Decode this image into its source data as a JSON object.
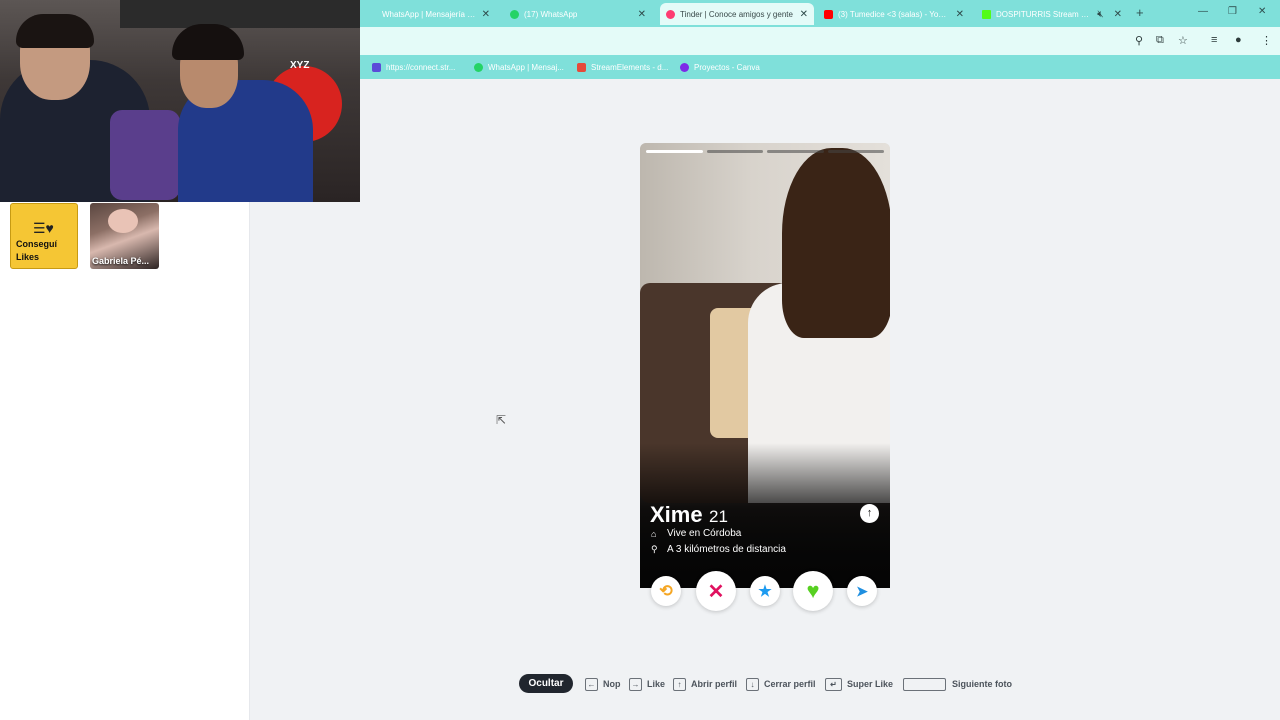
{
  "browser": {
    "tabs": [
      {
        "label": "WhatsApp | Mensajería y llama",
        "icon": "whatsapp-icon",
        "color": "#25d366"
      },
      {
        "label": "(17) WhatsApp",
        "icon": "whatsapp-icon",
        "color": "#25d366"
      },
      {
        "label": "Tinder | Conoce amigos y gente",
        "icon": "tinder-flame-icon",
        "color": "#fe3c72",
        "active": true
      },
      {
        "label": "(3) Tumedice <3 (salas) - YouTu",
        "icon": "youtube-icon",
        "color": "#ff0000"
      },
      {
        "label": "DOSPITURRIS Stream - Wat",
        "icon": "kick-icon",
        "color": "#53fc18"
      }
    ],
    "bookmarks": [
      {
        "label": "https://connect.str...",
        "icon": "bookmark-icon",
        "color": "#5b4bd8"
      },
      {
        "label": "WhatsApp | Mensaj...",
        "icon": "whatsapp-icon",
        "color": "#25d366"
      },
      {
        "label": "StreamElements - d...",
        "icon": "streamelements-icon",
        "color": "#e64a3a"
      },
      {
        "label": "Proyectos - Canva",
        "icon": "canva-icon",
        "color": "#7d2ae8"
      }
    ]
  },
  "sidebar": {
    "get_likes_label": "Conseguí Likes",
    "match_name": "Gabriela Pé..."
  },
  "webcam": {
    "overlay_text": "XYZ"
  },
  "profile": {
    "name": "Xime",
    "age": "21",
    "lives_in": "Vive en Córdoba",
    "distance": "A 3 kilómetros de distancia",
    "photo_count": 4,
    "current_photo": 1
  },
  "actions": [
    {
      "name": "rewind-button",
      "icon": "rewind-icon",
      "glyph": "⟲",
      "color": "#f5a623"
    },
    {
      "name": "nope-button",
      "icon": "x-icon",
      "glyph": "✕",
      "color": "#e0115f"
    },
    {
      "name": "super-like-button",
      "icon": "star-icon",
      "glyph": "★",
      "color": "#1d9bf0"
    },
    {
      "name": "like-button",
      "icon": "heart-icon",
      "glyph": "♥",
      "color": "#57d021"
    },
    {
      "name": "boost-button",
      "icon": "send-icon",
      "glyph": "➤",
      "color": "#1f8fe0"
    }
  ],
  "shortcuts": {
    "hide_label": "Ocultar",
    "items": [
      {
        "key": "←",
        "label": "Nop"
      },
      {
        "key": "→",
        "label": "Like"
      },
      {
        "key": "↑",
        "label": "Abrir perfil"
      },
      {
        "key": "↓",
        "label": "Cerrar perfil"
      },
      {
        "key": "↵",
        "label": "Super Like"
      },
      {
        "key": "",
        "label": "Siguiente foto"
      }
    ]
  }
}
